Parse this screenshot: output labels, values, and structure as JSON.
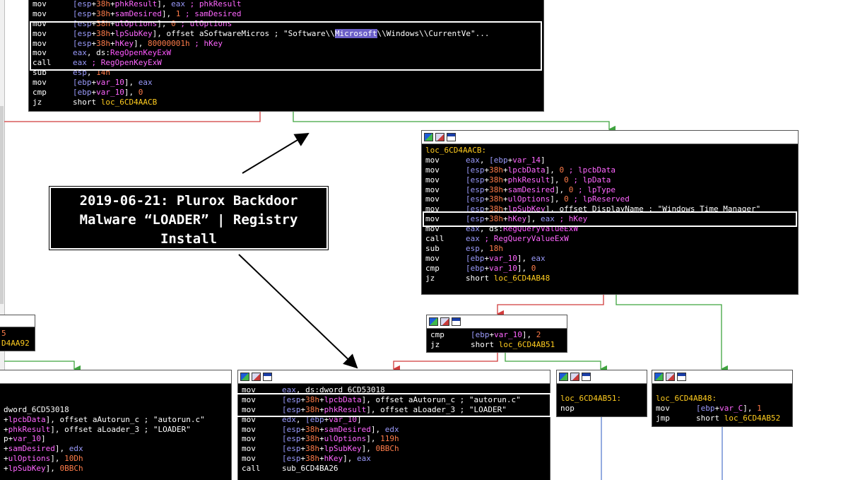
{
  "caption": {
    "line1": "2019-06-21: Plurox Backdoor",
    "line2": "Malware “LOADER” | Registry",
    "line3": "Install"
  },
  "colors": {
    "edge_true": "#3fa33f",
    "edge_false": "#d03b3b",
    "edge_uncond": "#5b7fd0",
    "background": "#000000",
    "register": "#9a9afb",
    "number": "#ff7c4a",
    "variable": "#ff66ff",
    "symbol": "#ffcc1f"
  },
  "icons": [
    "graph-icon",
    "edit-icon",
    "view-icon"
  ],
  "nodes": {
    "top": {
      "rows": [
        [
          [
            "mn",
            "mov"
          ],
          [
            "reg",
            "[esp"
          ],
          [
            "txt",
            "+"
          ],
          [
            "num",
            "38h"
          ],
          [
            "txt",
            "+"
          ],
          [
            "var",
            "phkResult"
          ],
          [
            "txt",
            "], "
          ],
          [
            "reg",
            "eax"
          ],
          [
            "cmt",
            " ; phkResult"
          ]
        ],
        [
          [
            "mn",
            "mov"
          ],
          [
            "reg",
            "[esp"
          ],
          [
            "txt",
            "+"
          ],
          [
            "num",
            "38h"
          ],
          [
            "txt",
            "+"
          ],
          [
            "var",
            "samDesired"
          ],
          [
            "txt",
            "], "
          ],
          [
            "num",
            "1"
          ],
          [
            "cmt",
            " ; samDesired"
          ]
        ],
        [
          [
            "mn",
            "mov"
          ],
          [
            "reg",
            "[esp"
          ],
          [
            "txt",
            "+"
          ],
          [
            "num",
            "38h"
          ],
          [
            "txt",
            "+"
          ],
          [
            "var",
            "ulOptions"
          ],
          [
            "txt",
            "], "
          ],
          [
            "num",
            "0"
          ],
          [
            "cmt",
            " ; ulOptions"
          ]
        ],
        [
          [
            "mn",
            "mov"
          ],
          [
            "reg",
            "[esp"
          ],
          [
            "txt",
            "+"
          ],
          [
            "num",
            "38h"
          ],
          [
            "txt",
            "+"
          ],
          [
            "var",
            "lpSubKey"
          ],
          [
            "txt",
            "], offset aSoftwareMicros ; \"Software\\\\"
          ],
          [
            "hl",
            "Microsoft"
          ],
          [
            "txt",
            "\\\\Windows\\\\CurrentVe\"..."
          ]
        ],
        [
          [
            "mn",
            "mov"
          ],
          [
            "reg",
            "[esp"
          ],
          [
            "txt",
            "+"
          ],
          [
            "num",
            "38h"
          ],
          [
            "txt",
            "+"
          ],
          [
            "var",
            "hKey"
          ],
          [
            "txt",
            "], "
          ],
          [
            "num",
            "80000001h"
          ],
          [
            "cmt",
            " ; hKey"
          ]
        ],
        [
          [
            "mn",
            "mov"
          ],
          [
            "reg",
            "eax"
          ],
          [
            "txt",
            ", ds:"
          ],
          [
            "api",
            "RegOpenKeyExW"
          ]
        ],
        [
          [
            "mn",
            "call"
          ],
          [
            "reg",
            "eax"
          ],
          [
            "cmt",
            " ; RegOpenKeyExW"
          ]
        ],
        [
          [
            "mn",
            "sub"
          ],
          [
            "reg",
            "esp"
          ],
          [
            "txt",
            ", "
          ],
          [
            "num",
            "14h"
          ]
        ],
        [
          [
            "mn",
            "mov"
          ],
          [
            "reg",
            "[ebp"
          ],
          [
            "txt",
            "+"
          ],
          [
            "var",
            "var_10"
          ],
          [
            "txt",
            "], "
          ],
          [
            "reg",
            "eax"
          ]
        ],
        [
          [
            "mn",
            "cmp"
          ],
          [
            "reg",
            "[ebp"
          ],
          [
            "txt",
            "+"
          ],
          [
            "var",
            "var_10"
          ],
          [
            "txt",
            "], "
          ],
          [
            "num",
            "0"
          ]
        ],
        [
          [
            "mn",
            "jz"
          ],
          [
            "txt",
            "short "
          ],
          [
            "sym",
            "loc_6CD4AACB"
          ]
        ]
      ]
    },
    "aacb": {
      "label": "loc_6CD4AACB:",
      "rows": [
        [
          [
            "mn",
            "mov"
          ],
          [
            "reg",
            "eax"
          ],
          [
            "txt",
            ", "
          ],
          [
            "reg",
            "[ebp"
          ],
          [
            "txt",
            "+"
          ],
          [
            "var",
            "var_14"
          ],
          [
            "txt",
            "]"
          ]
        ],
        [
          [
            "mn",
            "mov"
          ],
          [
            "reg",
            "[esp"
          ],
          [
            "txt",
            "+"
          ],
          [
            "num",
            "38h"
          ],
          [
            "txt",
            "+"
          ],
          [
            "var",
            "lpcbData"
          ],
          [
            "txt",
            "], "
          ],
          [
            "num",
            "0"
          ],
          [
            "cmt",
            " ; lpcbData"
          ]
        ],
        [
          [
            "mn",
            "mov"
          ],
          [
            "reg",
            "[esp"
          ],
          [
            "txt",
            "+"
          ],
          [
            "num",
            "38h"
          ],
          [
            "txt",
            "+"
          ],
          [
            "var",
            "phkResult"
          ],
          [
            "txt",
            "], "
          ],
          [
            "num",
            "0"
          ],
          [
            "cmt",
            " ; lpData"
          ]
        ],
        [
          [
            "mn",
            "mov"
          ],
          [
            "reg",
            "[esp"
          ],
          [
            "txt",
            "+"
          ],
          [
            "num",
            "38h"
          ],
          [
            "txt",
            "+"
          ],
          [
            "var",
            "samDesired"
          ],
          [
            "txt",
            "], "
          ],
          [
            "num",
            "0"
          ],
          [
            "cmt",
            " ; lpType"
          ]
        ],
        [
          [
            "mn",
            "mov"
          ],
          [
            "reg",
            "[esp"
          ],
          [
            "txt",
            "+"
          ],
          [
            "num",
            "38h"
          ],
          [
            "txt",
            "+"
          ],
          [
            "var",
            "ulOptions"
          ],
          [
            "txt",
            "], "
          ],
          [
            "num",
            "0"
          ],
          [
            "cmt",
            " ; lpReserved"
          ]
        ],
        [
          [
            "mn",
            "mov"
          ],
          [
            "reg",
            "[esp"
          ],
          [
            "txt",
            "+"
          ],
          [
            "num",
            "38h"
          ],
          [
            "txt",
            "+"
          ],
          [
            "var",
            "lpSubKey"
          ],
          [
            "txt",
            "], offset "
          ],
          [
            "txt",
            "DisplayName"
          ],
          [
            "txt",
            " ; \"Windows Time Manager\""
          ]
        ],
        [
          [
            "mn",
            "mov"
          ],
          [
            "reg",
            "[esp"
          ],
          [
            "txt",
            "+"
          ],
          [
            "num",
            "38h"
          ],
          [
            "txt",
            "+"
          ],
          [
            "var",
            "hKey"
          ],
          [
            "txt",
            "], "
          ],
          [
            "reg",
            "eax"
          ],
          [
            "cmt",
            " ; hKey"
          ]
        ],
        [
          [
            "mn",
            "mov"
          ],
          [
            "reg",
            "eax"
          ],
          [
            "txt",
            ", ds:"
          ],
          [
            "api",
            "RegQueryValueExW"
          ]
        ],
        [
          [
            "mn",
            "call"
          ],
          [
            "reg",
            "eax"
          ],
          [
            "cmt",
            " ; RegQueryValueExW"
          ]
        ],
        [
          [
            "mn",
            "sub"
          ],
          [
            "reg",
            "esp"
          ],
          [
            "txt",
            ", "
          ],
          [
            "num",
            "18h"
          ]
        ],
        [
          [
            "mn",
            "mov"
          ],
          [
            "reg",
            "[ebp"
          ],
          [
            "txt",
            "+"
          ],
          [
            "var",
            "var_10"
          ],
          [
            "txt",
            "], "
          ],
          [
            "reg",
            "eax"
          ]
        ],
        [
          [
            "mn",
            "cmp"
          ],
          [
            "reg",
            "[ebp"
          ],
          [
            "txt",
            "+"
          ],
          [
            "var",
            "var_10"
          ],
          [
            "txt",
            "], "
          ],
          [
            "num",
            "0"
          ]
        ],
        [
          [
            "mn",
            "jz"
          ],
          [
            "txt",
            "short "
          ],
          [
            "sym",
            "loc_6CD4AB48"
          ]
        ]
      ]
    },
    "cmp2": {
      "rows": [
        [
          [
            "mn",
            "cmp"
          ],
          [
            "reg",
            "[ebp"
          ],
          [
            "txt",
            "+"
          ],
          [
            "var",
            "var_10"
          ],
          [
            "txt",
            "], "
          ],
          [
            "num",
            "2"
          ]
        ],
        [
          [
            "mn",
            "jz"
          ],
          [
            "txt",
            "short "
          ],
          [
            "sym",
            "loc_6CD4AB51"
          ]
        ]
      ]
    },
    "leftfrag": {
      "rows": [
        [
          [
            "num",
            "5"
          ]
        ],
        [
          [
            "sym",
            "D4AA92"
          ]
        ]
      ]
    },
    "leftbig": {
      "rows": [
        [
          [
            "txt",
            ""
          ]
        ],
        [
          [
            "txt",
            ""
          ]
        ],
        [
          [
            "txt",
            "dword_6CD53018"
          ]
        ],
        [
          [
            "txt",
            "+"
          ],
          [
            "var",
            "lpcbData"
          ],
          [
            "txt",
            "], offset aAutorun_c ; \"autorun.c\""
          ]
        ],
        [
          [
            "txt",
            "+"
          ],
          [
            "var",
            "phkResult"
          ],
          [
            "txt",
            "], offset aLoader_3 ; \"LOADER\""
          ]
        ],
        [
          [
            "txt",
            "p+"
          ],
          [
            "var",
            "var_10"
          ],
          [
            "txt",
            "]"
          ]
        ],
        [
          [
            "txt",
            "+"
          ],
          [
            "var",
            "samDesired"
          ],
          [
            "txt",
            "], "
          ],
          [
            "reg",
            "edx"
          ]
        ],
        [
          [
            "txt",
            "+"
          ],
          [
            "var",
            "ulOptions"
          ],
          [
            "txt",
            "], "
          ],
          [
            "num",
            "10Dh"
          ]
        ],
        [
          [
            "txt",
            "+"
          ],
          [
            "var",
            "lpSubKey"
          ],
          [
            "txt",
            "], "
          ],
          [
            "num",
            "0BBCh"
          ]
        ]
      ]
    },
    "mid": {
      "rows": [
        [
          [
            "mn",
            "mov"
          ],
          [
            "reg",
            "eax"
          ],
          [
            "txt",
            ", ds:dword_6CD53018"
          ]
        ],
        [
          [
            "mn",
            "mov"
          ],
          [
            "reg",
            "[esp"
          ],
          [
            "txt",
            "+"
          ],
          [
            "num",
            "38h"
          ],
          [
            "txt",
            "+"
          ],
          [
            "var",
            "lpcbData"
          ],
          [
            "txt",
            "], offset aAutorun_c ; \"autorun.c\""
          ]
        ],
        [
          [
            "mn",
            "mov"
          ],
          [
            "reg",
            "[esp"
          ],
          [
            "txt",
            "+"
          ],
          [
            "num",
            "38h"
          ],
          [
            "txt",
            "+"
          ],
          [
            "var",
            "phkResult"
          ],
          [
            "txt",
            "], offset aLoader_3 ; \"LOADER\""
          ]
        ],
        [
          [
            "mn",
            "mov"
          ],
          [
            "reg",
            "edx"
          ],
          [
            "txt",
            ", "
          ],
          [
            "reg",
            "[ebp"
          ],
          [
            "txt",
            "+"
          ],
          [
            "var",
            "var_10"
          ],
          [
            "txt",
            "]"
          ]
        ],
        [
          [
            "mn",
            "mov"
          ],
          [
            "reg",
            "[esp"
          ],
          [
            "txt",
            "+"
          ],
          [
            "num",
            "38h"
          ],
          [
            "txt",
            "+"
          ],
          [
            "var",
            "samDesired"
          ],
          [
            "txt",
            "], "
          ],
          [
            "reg",
            "edx"
          ]
        ],
        [
          [
            "mn",
            "mov"
          ],
          [
            "reg",
            "[esp"
          ],
          [
            "txt",
            "+"
          ],
          [
            "num",
            "38h"
          ],
          [
            "txt",
            "+"
          ],
          [
            "var",
            "ulOptions"
          ],
          [
            "txt",
            "], "
          ],
          [
            "num",
            "119h"
          ]
        ],
        [
          [
            "mn",
            "mov"
          ],
          [
            "reg",
            "[esp"
          ],
          [
            "txt",
            "+"
          ],
          [
            "num",
            "38h"
          ],
          [
            "txt",
            "+"
          ],
          [
            "var",
            "lpSubKey"
          ],
          [
            "txt",
            "], "
          ],
          [
            "num",
            "0BBCh"
          ]
        ],
        [
          [
            "mn",
            "mov"
          ],
          [
            "reg",
            "[esp"
          ],
          [
            "txt",
            "+"
          ],
          [
            "num",
            "38h"
          ],
          [
            "txt",
            "+"
          ],
          [
            "var",
            "hKey"
          ],
          [
            "txt",
            "], "
          ],
          [
            "reg",
            "eax"
          ]
        ],
        [
          [
            "mn",
            "call"
          ],
          [
            "txt",
            "sub_6CD4BA26"
          ]
        ]
      ]
    },
    "ab51": {
      "label": "loc_6CD4AB51:",
      "rows": [
        [
          [
            "mn",
            "nop"
          ]
        ]
      ]
    },
    "ab48": {
      "label": "loc_6CD4AB48:",
      "rows": [
        [
          [
            "mn",
            "mov"
          ],
          [
            "reg",
            "[ebp"
          ],
          [
            "txt",
            "+"
          ],
          [
            "var",
            "var_C"
          ],
          [
            "txt",
            "], "
          ],
          [
            "num",
            "1"
          ]
        ],
        [
          [
            "mn",
            "jmp"
          ],
          [
            "txt",
            "short "
          ],
          [
            "sym",
            "loc_6CD4AB52"
          ]
        ]
      ]
    }
  }
}
